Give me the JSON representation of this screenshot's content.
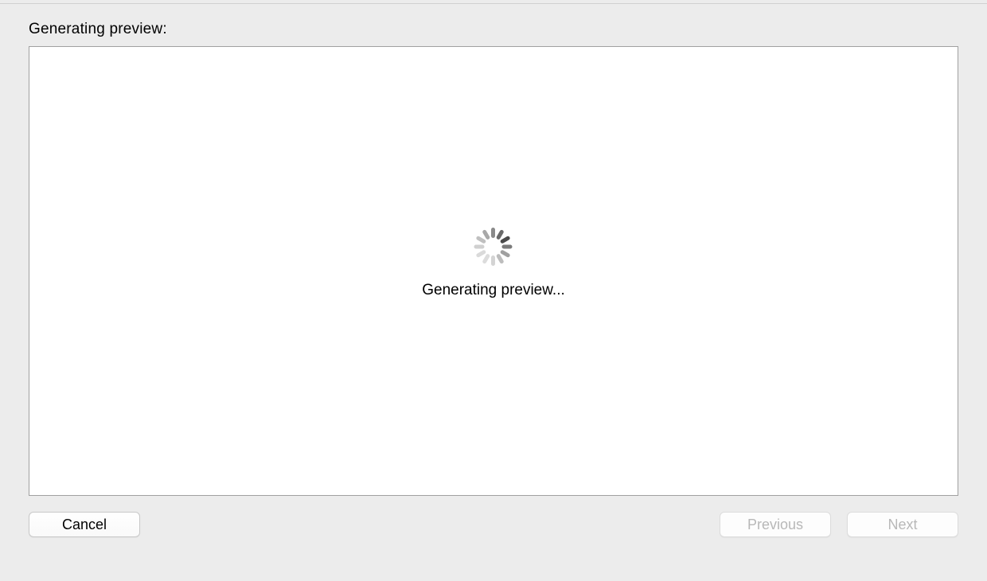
{
  "heading": "Generating preview:",
  "preview": {
    "status_text": "Generating preview..."
  },
  "footer": {
    "cancel_label": "Cancel",
    "previous_label": "Previous",
    "next_label": "Next"
  }
}
